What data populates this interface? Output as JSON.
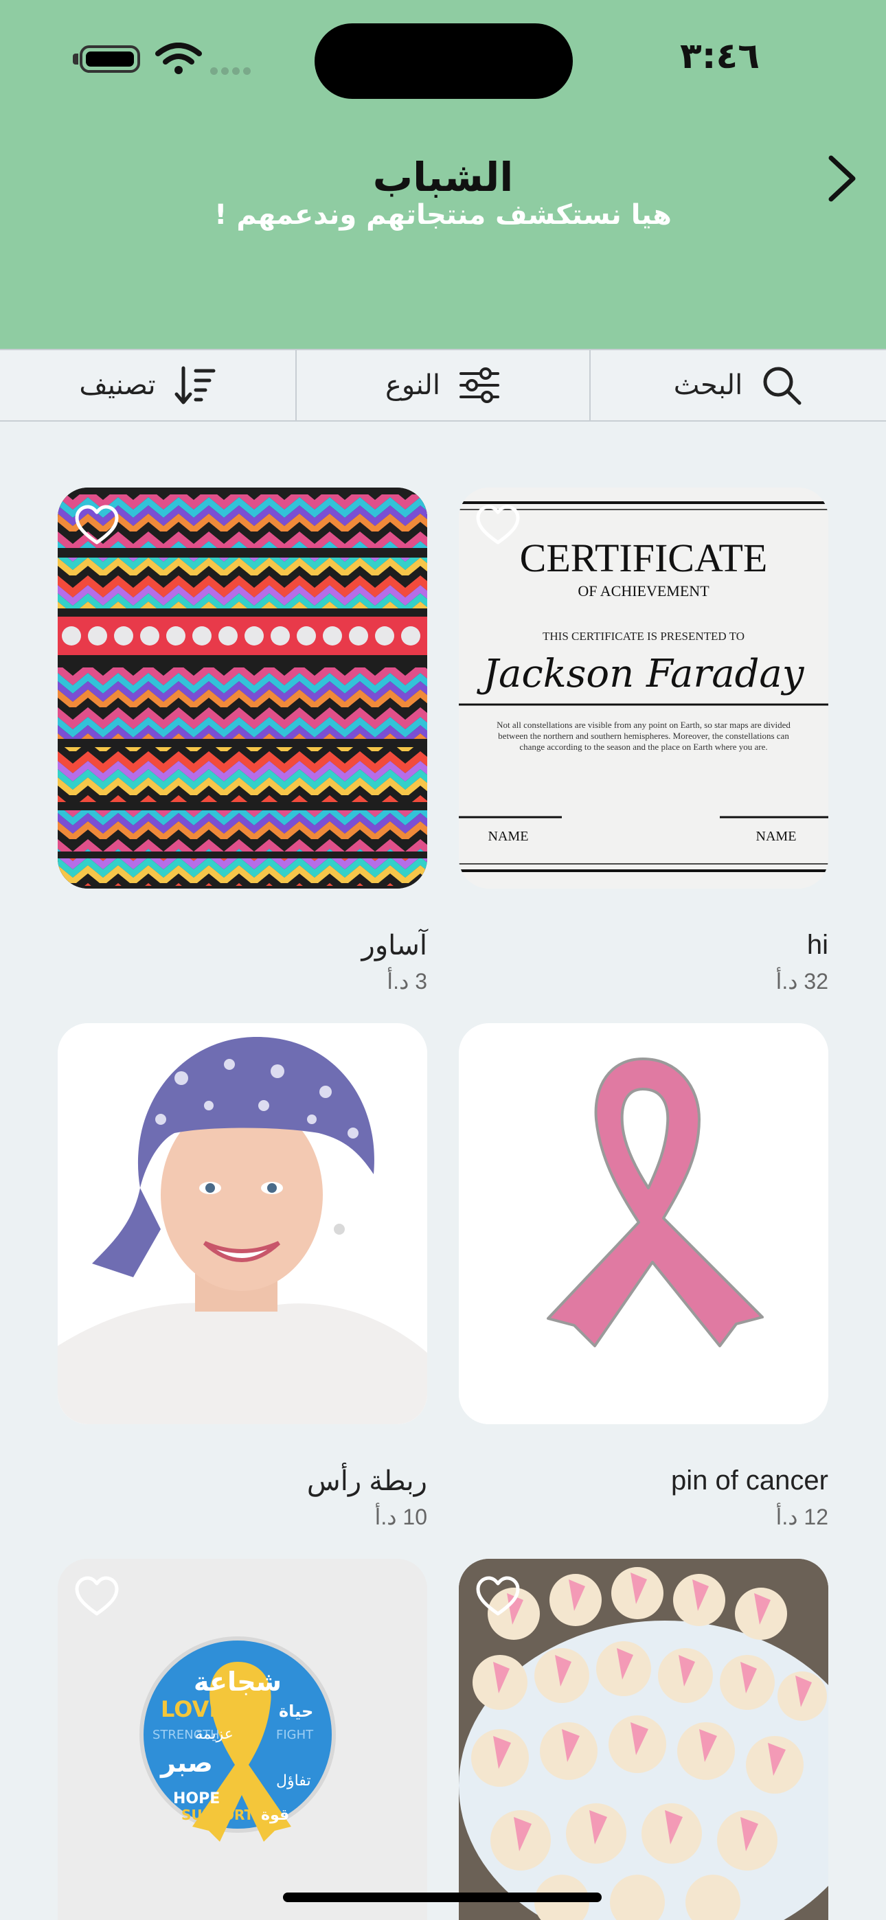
{
  "status_bar": {
    "time": "٣:٤٦"
  },
  "header": {
    "title": "الشباب",
    "subtitle": "هيا نستكشف منتجاتهم وندعمهم !",
    "back_icon": "chevron-right-icon",
    "background_color": "#8fcca2"
  },
  "toolbar": {
    "search_label": "البحث",
    "type_label": "النوع",
    "sort_label": "تصنيف"
  },
  "products": [
    {
      "name": "hi",
      "price": "32 د.أ",
      "image": "certificate",
      "certificate": {
        "heading": "CERTIFICATE",
        "subheading": "OF ACHIEVEMENT",
        "presented": "THIS CERTIFICATE IS PRESENTED TO",
        "recipient": "Jackson Faraday",
        "body_line1": "Not all constellations are visible from any point on Earth, so star maps are divided",
        "body_line2": "between the northern and southern hemispheres. Moreover, the constellations can",
        "body_line3": "change according to the season and the place on Earth where you are.",
        "sig_left": "NAME",
        "sig_right": "NAME"
      }
    },
    {
      "name": "آساور",
      "price": "3 د.أ",
      "image": "bracelets"
    },
    {
      "name": "pin of cancer",
      "price": "12 د.أ",
      "image": "pink-ribbon-pin"
    },
    {
      "name": "ربطة رأس",
      "price": "10 د.أ",
      "image": "woman-headscarf"
    },
    {
      "name": "",
      "price": "",
      "image": "pink-ribbon-cupcakes"
    },
    {
      "name": "",
      "price": "",
      "image": "yellow-ribbon-badge",
      "badge_words": [
        "شجاعة",
        "LOVE",
        "صبر",
        "HOPE",
        "SUPPORT",
        "STRENGTH",
        "FIGHT",
        "حياة",
        "قوة",
        "عزيمة",
        "تفاؤل"
      ]
    }
  ]
}
